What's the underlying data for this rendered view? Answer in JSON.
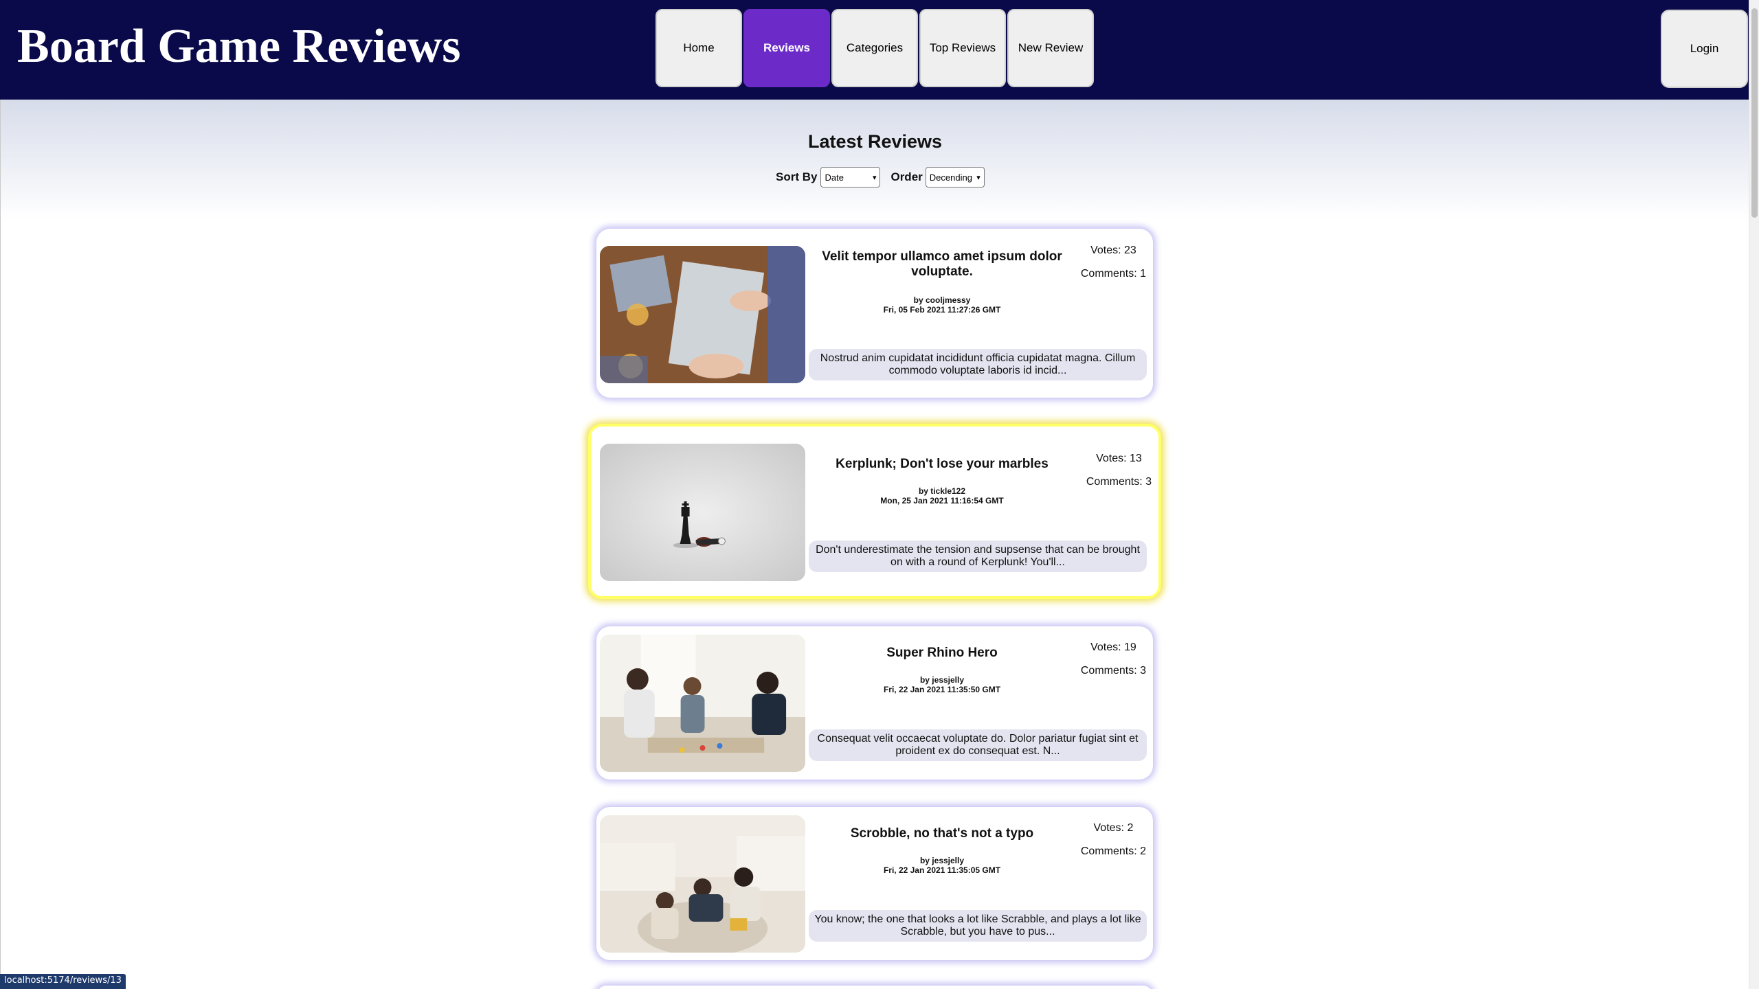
{
  "header": {
    "title": "Board Game Reviews",
    "nav": [
      {
        "label": "Home",
        "active": false
      },
      {
        "label": "Reviews",
        "active": true
      },
      {
        "label": "Categories",
        "active": false
      },
      {
        "label": "Top Reviews",
        "active": false
      },
      {
        "label": "New Review",
        "active": false
      }
    ],
    "login_label": "Login"
  },
  "main": {
    "heading": "Latest Reviews",
    "sort_by_label": "Sort By",
    "sort_by_value": "Date",
    "order_label": "Order",
    "order_value": "Decending"
  },
  "reviews": [
    {
      "title": "Velit tempor ullamco amet ipsum dolor voluptate.",
      "author": "by cooljmessy",
      "date": "Fri, 05 Feb 2021 11:27:26 GMT",
      "votes": "Votes: 23",
      "comments": "Comments: 1",
      "body": "Nostrud anim cupidatat incididunt officia cupidatat magna. Cillum commodo voluptate laboris id incid..."
    },
    {
      "title": "Kerplunk; Don't lose your marbles",
      "author": "by tickle122",
      "date": "Mon, 25 Jan 2021 11:16:54 GMT",
      "votes": "Votes: 13",
      "comments": "Comments: 3",
      "body": "Don't underestimate the tension and supsense that can be brought on with a round of Kerplunk! You'll..."
    },
    {
      "title": "Super Rhino Hero",
      "author": "by jessjelly",
      "date": "Fri, 22 Jan 2021 11:35:50 GMT",
      "votes": "Votes: 19",
      "comments": "Comments: 3",
      "body": "Consequat velit occaecat voluptate do. Dolor pariatur fugiat sint et proident ex do consequat est. N..."
    },
    {
      "title": "Scrobble, no that's not a typo",
      "author": "by jessjelly",
      "date": "Fri, 22 Jan 2021 11:35:05 GMT",
      "votes": "Votes: 2",
      "comments": "Comments: 2",
      "body": "You know; the one that looks a lot like Scrabble, and plays a lot like Scrabble, but you have to pus..."
    }
  ],
  "status_bar": {
    "url": "localhost:5174/reviews/13"
  },
  "colors": {
    "header_bg": "#0a0a4a",
    "nav_active": "#6c2bc9",
    "highlight_border": "#ffff66"
  }
}
